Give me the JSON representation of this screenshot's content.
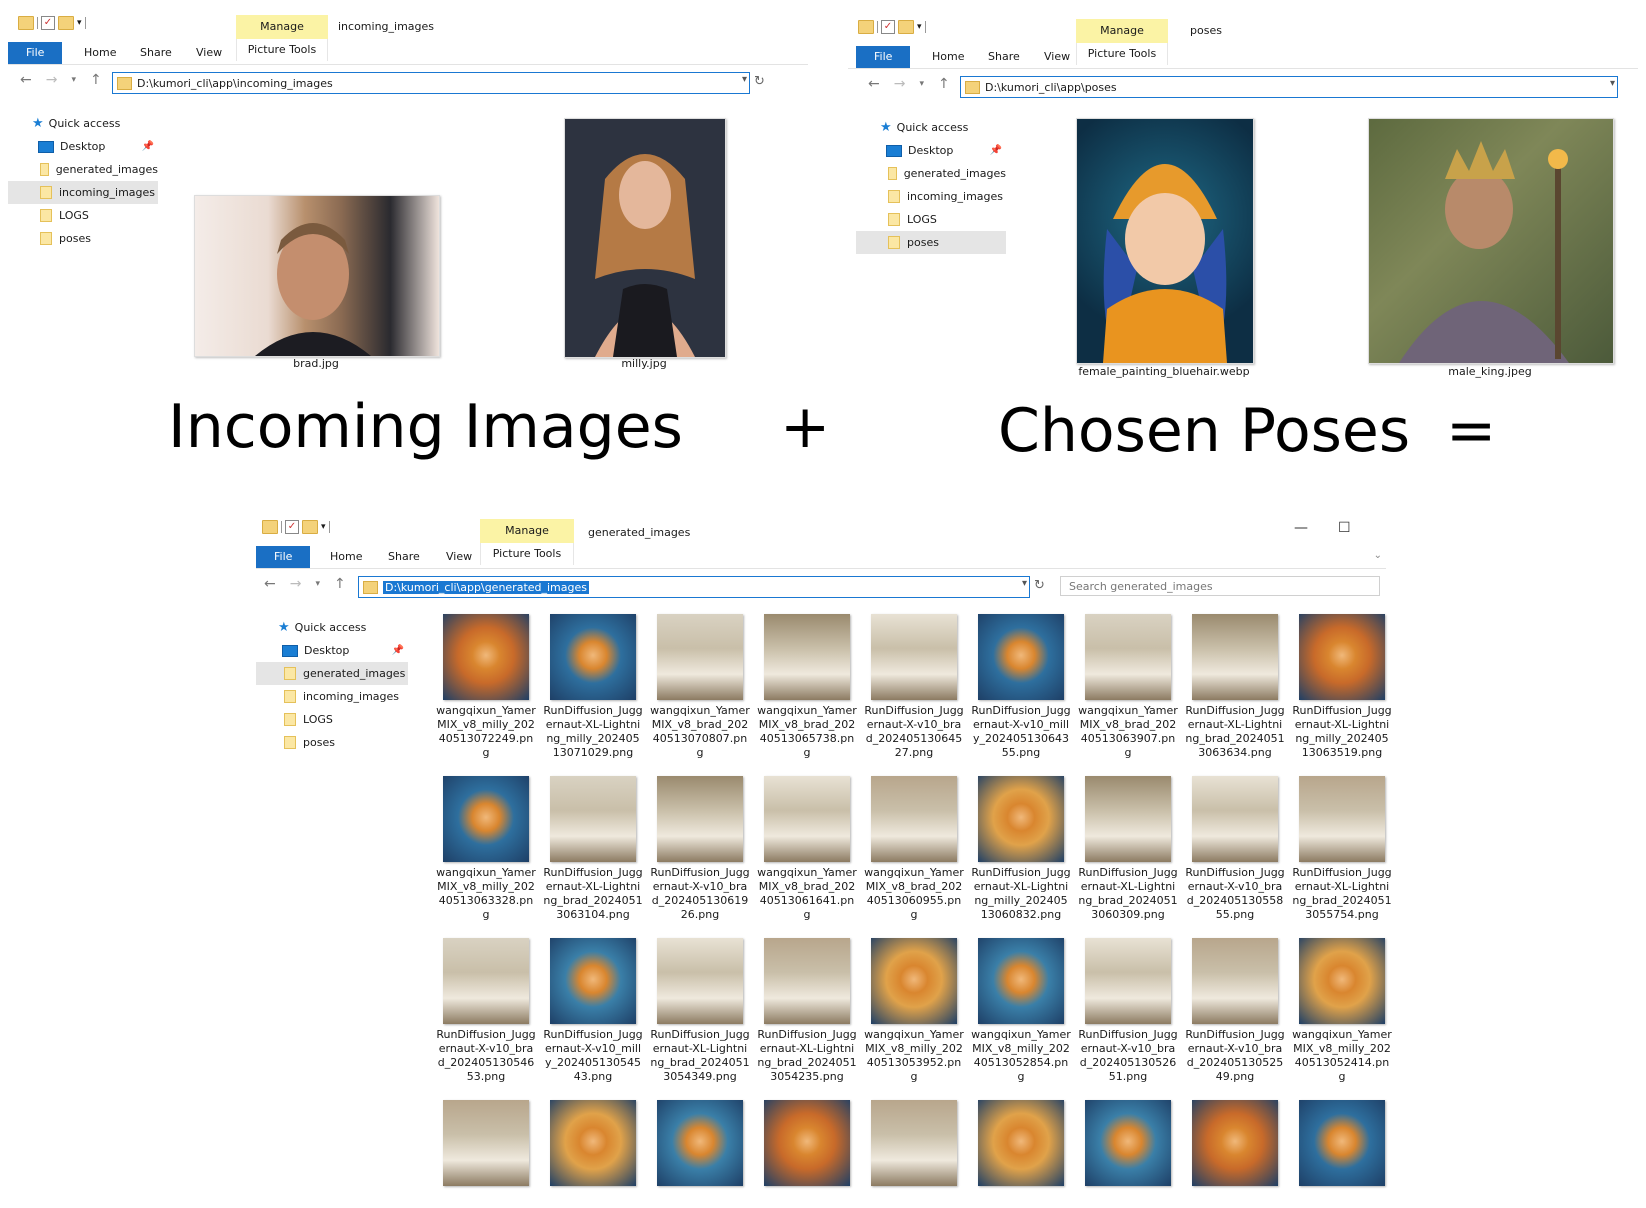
{
  "labels": {
    "incoming": "Incoming Images",
    "plus": "+",
    "poses": "Chosen Poses",
    "equals": "="
  },
  "ribbon": {
    "file": "File",
    "home": "Home",
    "share": "Share",
    "view": "View",
    "manage": "Manage",
    "picture_tools": "Picture Tools"
  },
  "sidebar_items": {
    "quick_access": "Quick access",
    "desktop": "Desktop",
    "generated": "generated_images",
    "incoming": "incoming_images",
    "logs": "LOGS",
    "poses": "poses"
  },
  "window1": {
    "title": "incoming_images",
    "address": "D:\\kumori_cli\\app\\incoming_images",
    "files": [
      "brad.jpg",
      "milly.jpg"
    ]
  },
  "window2": {
    "title": "poses",
    "address": "D:\\kumori_cli\\app\\poses",
    "files": [
      "female_painting_bluehair.webp",
      "male_king.jpeg"
    ]
  },
  "window3": {
    "title": "generated_images",
    "address": "D:\\kumori_cli\\app\\generated_images",
    "search_placeholder": "Search generated_images",
    "files": [
      "wangqixun_YamerMIX_v8_milly_20240513072249.png",
      "RunDiffusion_Juggernaut-XL-Lightning_milly_20240513071029.png",
      "wangqixun_YamerMIX_v8_brad_20240513070807.png",
      "wangqixun_YamerMIX_v8_brad_20240513065738.png",
      "RunDiffusion_Juggernaut-X-v10_brad_20240513064527.png",
      "RunDiffusion_Juggernaut-X-v10_milly_20240513064355.png",
      "wangqixun_YamerMIX_v8_brad_20240513063907.png",
      "RunDiffusion_Juggernaut-XL-Lightning_brad_20240513063634.png",
      "RunDiffusion_Juggernaut-XL-Lightning_milly_20240513063519.png",
      "wangqixun_YamerMIX_v8_milly_20240513063328.png",
      "RunDiffusion_Juggernaut-XL-Lightning_brad_20240513063104.png",
      "RunDiffusion_Juggernaut-X-v10_brad_20240513061926.png",
      "wangqixun_YamerMIX_v8_brad_20240513061641.png",
      "wangqixun_YamerMIX_v8_brad_20240513060955.png",
      "RunDiffusion_Juggernaut-XL-Lightning_milly_20240513060832.png",
      "RunDiffusion_Juggernaut-XL-Lightning_brad_20240513060309.png",
      "RunDiffusion_Juggernaut-X-v10_brad_20240513055855.png",
      "RunDiffusion_Juggernaut-XL-Lightning_brad_20240513055754.png",
      "RunDiffusion_Juggernaut-X-v10_brad_20240513054653.png",
      "RunDiffusion_Juggernaut-X-v10_milly_20240513054543.png",
      "RunDiffusion_Juggernaut-XL-Lightning_brad_20240513054349.png",
      "RunDiffusion_Juggernaut-XL-Lightning_brad_20240513054235.png",
      "wangqixun_YamerMIX_v8_milly_20240513053952.png",
      "wangqixun_YamerMIX_v8_milly_20240513052854.png",
      "RunDiffusion_Juggernaut-X-v10_brad_20240513052651.png",
      "RunDiffusion_Juggernaut-X-v10_brad_20240513052549.png",
      "wangqixun_YamerMIX_v8_milly_20240513052414.png"
    ]
  }
}
